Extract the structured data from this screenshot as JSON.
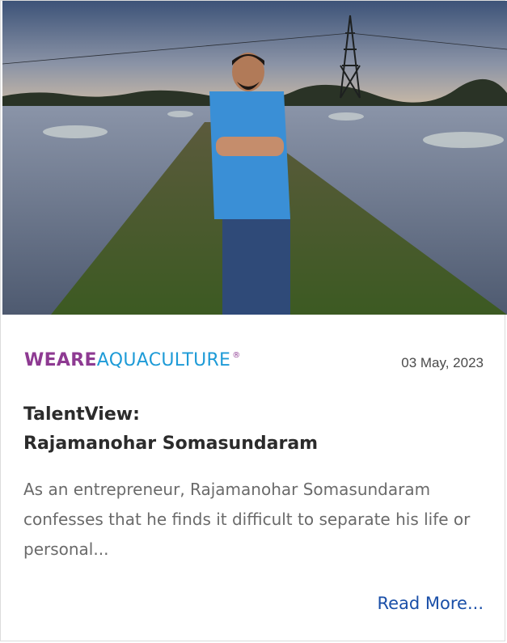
{
  "article": {
    "image_alt": "Man in blue shirt standing on path between aquaculture ponds at dusk",
    "logo": {
      "part1": "WEARE",
      "part2": "AQUACULTURE",
      "mark": "®"
    },
    "date": "03 May, 2023",
    "title_line1": "TalentView:",
    "title_line2": "Rajamanohar Somasundaram",
    "excerpt": "As an entrepreneur, Rajamanohar Somasundaram confesses that he finds it difficult to separate his life or personal...",
    "read_more": "Read More..."
  },
  "colors": {
    "logo_purple": "#8e3a92",
    "logo_blue": "#1e9bd7",
    "link_blue": "#1a4fa8"
  }
}
